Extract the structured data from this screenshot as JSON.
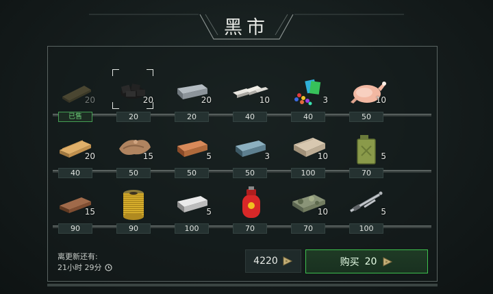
{
  "title": "黑市",
  "colors": {
    "accent_green": "#3ec24e",
    "sold_green": "#6ed07a",
    "panel_border": "#5a6462"
  },
  "items": [
    [
      {
        "name": "wooden-plank",
        "qty": "20",
        "price": "已售",
        "sold": true
      },
      {
        "name": "coal",
        "qty": "20",
        "price": "20",
        "selected": true
      },
      {
        "name": "iron-ingot",
        "qty": "20",
        "price": "20"
      },
      {
        "name": "silver-bars",
        "qty": "10",
        "price": "40"
      },
      {
        "name": "colorful-parts",
        "qty": "3",
        "price": "40"
      },
      {
        "name": "chicken",
        "qty": "10",
        "price": "50"
      }
    ],
    [
      {
        "name": "boards",
        "qty": "20",
        "price": "40"
      },
      {
        "name": "leather",
        "qty": "15",
        "price": "50"
      },
      {
        "name": "copper-ingot",
        "qty": "5",
        "price": "50"
      },
      {
        "name": "steel-ingot",
        "qty": "3",
        "price": "50"
      },
      {
        "name": "fabric",
        "qty": "10",
        "price": "100"
      },
      {
        "name": "jerrycan",
        "qty": "5",
        "price": "70"
      }
    ],
    [
      {
        "name": "plank-brown",
        "qty": "15",
        "price": "90"
      },
      {
        "name": "oil-filter",
        "qty": "",
        "price": "90"
      },
      {
        "name": "aluminum-ingot",
        "qty": "5",
        "price": "100"
      },
      {
        "name": "gas-cylinder",
        "qty": "",
        "price": "70"
      },
      {
        "name": "camo-cloth",
        "qty": "10",
        "price": "70"
      },
      {
        "name": "gun-parts",
        "qty": "5",
        "price": "100"
      }
    ]
  ],
  "footer": {
    "refresh_label": "离更新还有:",
    "refresh_time": "21小时 29分",
    "balance": "4220",
    "buy_label": "购买",
    "buy_price": "20"
  }
}
